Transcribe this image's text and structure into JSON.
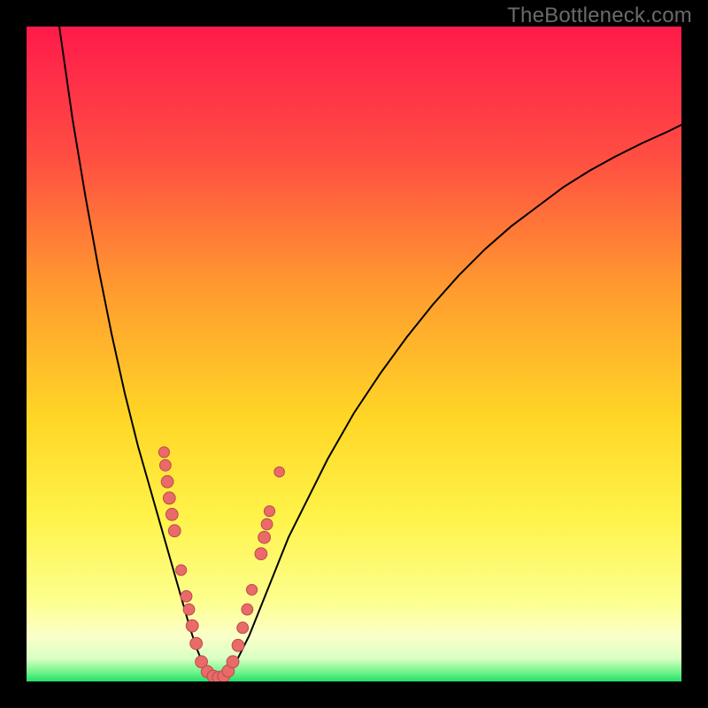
{
  "watermark": "TheBottleneck.com",
  "chart_data": {
    "type": "line",
    "title": "",
    "xlabel": "",
    "ylabel": "",
    "xlim": [
      0,
      100
    ],
    "ylim": [
      0,
      100
    ],
    "grid": false,
    "legend": false,
    "gradient_stops": [
      {
        "offset": 0.0,
        "color": "#ff1a4b"
      },
      {
        "offset": 0.2,
        "color": "#ff4e42"
      },
      {
        "offset": 0.4,
        "color": "#ff9b2f"
      },
      {
        "offset": 0.6,
        "color": "#ffd726"
      },
      {
        "offset": 0.75,
        "color": "#fff34a"
      },
      {
        "offset": 0.88,
        "color": "#fdff90"
      },
      {
        "offset": 0.93,
        "color": "#fbffc8"
      },
      {
        "offset": 0.965,
        "color": "#d9ffc4"
      },
      {
        "offset": 0.985,
        "color": "#74f58a"
      },
      {
        "offset": 1.0,
        "color": "#24e06a"
      }
    ],
    "series": [
      {
        "name": "left-curve",
        "color": "#000000",
        "x": [
          5,
          6,
          7,
          8,
          9,
          10,
          11,
          12,
          13,
          14,
          15,
          16,
          17,
          18,
          19,
          20,
          21,
          22,
          23,
          24,
          25,
          26,
          27,
          28
        ],
        "y": [
          100,
          93,
          86,
          80,
          74,
          68.5,
          63,
          58,
          53,
          48.5,
          44,
          40,
          36,
          32.5,
          29,
          25.5,
          22,
          18.5,
          15,
          11.5,
          8,
          5,
          2.5,
          0.5
        ]
      },
      {
        "name": "right-curve",
        "color": "#000000",
        "x": [
          30,
          32,
          34,
          36,
          38,
          40,
          43,
          46,
          50,
          54,
          58,
          62,
          66,
          70,
          74,
          78,
          82,
          86,
          90,
          94,
          98,
          100
        ],
        "y": [
          0.5,
          3,
          7,
          12,
          17,
          22,
          28,
          34,
          41,
          47,
          52.5,
          57.5,
          62,
          66,
          69.5,
          72.5,
          75.5,
          78,
          80.2,
          82.2,
          84,
          85
        ]
      }
    ],
    "scatter_points": {
      "name": "highlighted-samples",
      "color": "#ea6a6a",
      "stroke": "#b84b4b",
      "points": [
        {
          "x": 21.0,
          "y": 35.0,
          "r": 3.8
        },
        {
          "x": 21.2,
          "y": 33.0,
          "r": 4.0
        },
        {
          "x": 21.5,
          "y": 30.5,
          "r": 4.3
        },
        {
          "x": 21.8,
          "y": 28.0,
          "r": 4.3
        },
        {
          "x": 22.2,
          "y": 25.5,
          "r": 4.3
        },
        {
          "x": 22.6,
          "y": 23.0,
          "r": 4.3
        },
        {
          "x": 23.6,
          "y": 17.0,
          "r": 3.8
        },
        {
          "x": 24.4,
          "y": 13.0,
          "r": 4.0
        },
        {
          "x": 24.8,
          "y": 11.0,
          "r": 4.0
        },
        {
          "x": 25.3,
          "y": 8.5,
          "r": 4.3
        },
        {
          "x": 25.9,
          "y": 5.8,
          "r": 4.3
        },
        {
          "x": 26.7,
          "y": 3.0,
          "r": 4.3
        },
        {
          "x": 27.6,
          "y": 1.5,
          "r": 4.3
        },
        {
          "x": 28.5,
          "y": 0.8,
          "r": 4.3
        },
        {
          "x": 29.3,
          "y": 0.6,
          "r": 4.3
        },
        {
          "x": 30.1,
          "y": 0.8,
          "r": 4.3
        },
        {
          "x": 30.8,
          "y": 1.6,
          "r": 4.3
        },
        {
          "x": 31.5,
          "y": 3.0,
          "r": 4.3
        },
        {
          "x": 32.3,
          "y": 5.5,
          "r": 4.3
        },
        {
          "x": 33.0,
          "y": 8.2,
          "r": 4.0
        },
        {
          "x": 33.7,
          "y": 11.0,
          "r": 4.0
        },
        {
          "x": 34.4,
          "y": 14.0,
          "r": 3.8
        },
        {
          "x": 35.8,
          "y": 19.5,
          "r": 4.3
        },
        {
          "x": 36.3,
          "y": 22.0,
          "r": 4.3
        },
        {
          "x": 36.7,
          "y": 24.0,
          "r": 4.0
        },
        {
          "x": 37.1,
          "y": 26.0,
          "r": 3.8
        },
        {
          "x": 38.6,
          "y": 32.0,
          "r": 3.6
        }
      ]
    }
  }
}
